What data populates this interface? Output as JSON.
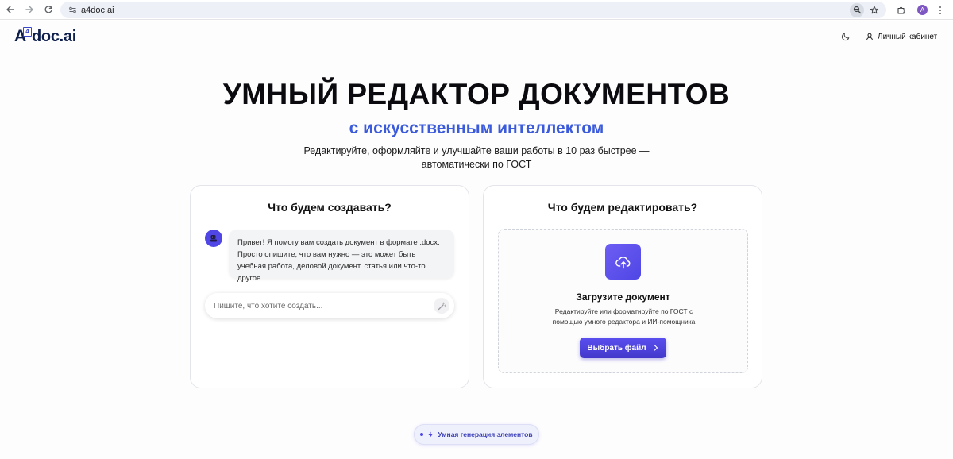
{
  "browser": {
    "url": "a4doc.ai",
    "profile_initial": "A"
  },
  "header": {
    "logo_badge": "4",
    "logo_prefix": "A",
    "logo_text": "doc.ai",
    "account_label": "Личный кабинет"
  },
  "hero": {
    "title": "УМНЫЙ РЕДАКТОР ДОКУМЕНТОВ",
    "subtitle": "с искусственным интеллектом",
    "description": "Редактируйте, оформляйте и улучшайте ваши работы в 10 раз быстрее — автоматически по ГОСТ"
  },
  "create_card": {
    "title": "Что будем создавать?",
    "bot_message": "Привет! Я помогу вам создать документ в формате .docx. Просто опишите, что вам нужно — это может быть учебная работа, деловой документ, статья или что-то другое.",
    "input_placeholder": "Пишите, что хотите создать..."
  },
  "edit_card": {
    "title": "Что будем редактировать?",
    "upload_title": "Загрузите документ",
    "upload_description": "Редактируйте или форматируйте по ГОСТ с помощью умного редактора и ИИ-помощника",
    "choose_button": "Выбрать файл"
  },
  "feature_pill": {
    "label": "Умная генерация элементов"
  },
  "colors": {
    "accent": "#4f46e5",
    "subtitle_blue": "#3b5bdb",
    "logo_navy": "#0f1f4d"
  }
}
